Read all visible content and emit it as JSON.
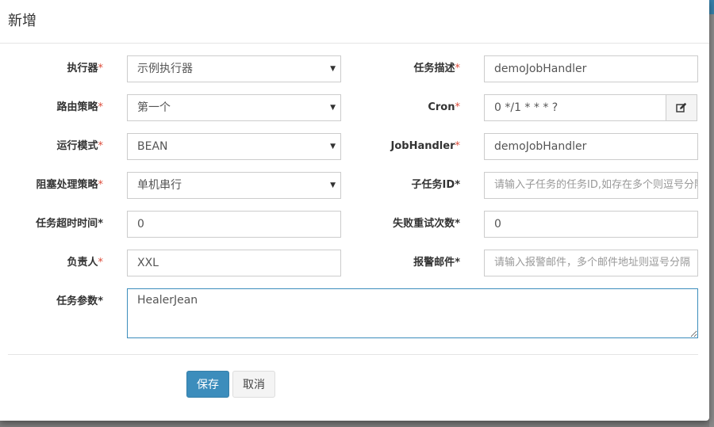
{
  "modal": {
    "title": "新增",
    "required_mark": "*"
  },
  "form": {
    "executor": {
      "label": "执行器",
      "value": "示例执行器"
    },
    "job_desc": {
      "label": "任务描述",
      "value": "demoJobHandler"
    },
    "route_strategy": {
      "label": "路由策略",
      "value": "第一个"
    },
    "cron": {
      "label": "Cron",
      "value": "0 */1 * * * ?"
    },
    "run_mode": {
      "label": "运行模式",
      "value": "BEAN"
    },
    "job_handler": {
      "label": "JobHandler",
      "value": "demoJobHandler"
    },
    "block_strategy": {
      "label": "阻塞处理策略",
      "value": "单机串行"
    },
    "child_job_id": {
      "label": "子任务ID",
      "placeholder": "请输入子任务的任务ID,如存在多个则逗号分隔"
    },
    "timeout": {
      "label": "任务超时时间",
      "value": "0"
    },
    "fail_retry": {
      "label": "失败重试次数",
      "value": "0"
    },
    "author": {
      "label": "负责人",
      "value": "XXL"
    },
    "alarm_email": {
      "label": "报警邮件",
      "placeholder": "请输入报警邮件，多个邮件地址则逗号分隔"
    },
    "job_param": {
      "label": "任务参数",
      "value": "HealerJean"
    }
  },
  "buttons": {
    "save": "保存",
    "cancel": "取消"
  },
  "colors": {
    "primary": "#3c8dbc",
    "required": "#dd4b39"
  },
  "icons": {
    "cron_addon": "edit-icon",
    "select_arrow": "caret-down-icon"
  }
}
